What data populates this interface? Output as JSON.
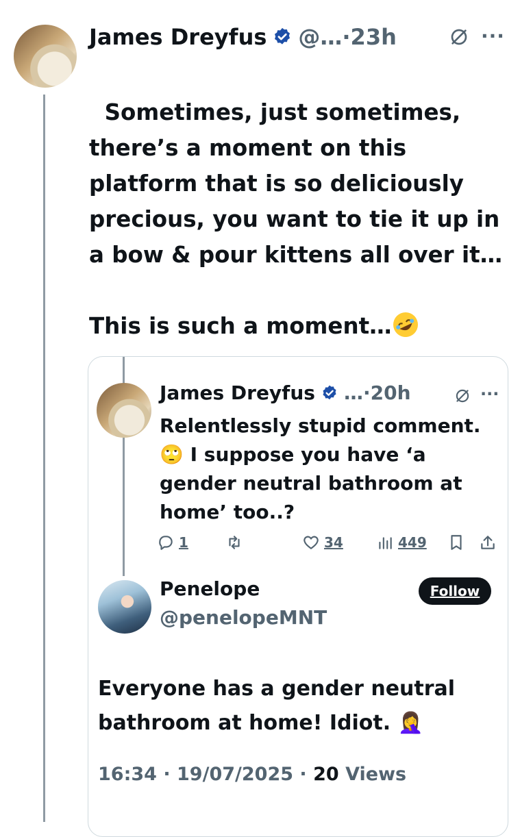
{
  "tweet": {
    "author_name": "James Dreyfus",
    "handle_truncated": "@…",
    "separator": "·",
    "time": "23h",
    "text_main": "Sometimes, just sometimes, there’s a moment on this platform that is so deliciously precious, you want to tie it up in a bow & pour kittens all over it…",
    "text_second": "This is such a moment…",
    "emoji": "rolling-on-floor-laughing",
    "verified": true
  },
  "quoted": {
    "author_name": "James Dreyfus",
    "handle_truncated": "…",
    "separator": "·",
    "time": "20h",
    "text": "Relentlessly stupid comment. 🙄 I suppose you have ‘a gender neutral bathroom at home’ too..?",
    "actions": {
      "reply_count": "1",
      "repost_count": "",
      "like_count": "34",
      "views_count": "449"
    },
    "reply": {
      "author_name": "Penelope",
      "handle": "@penelopeMNT",
      "follow_label": "Follow",
      "text": "Everyone has a gender neutral bathroom at home! Idiot. 🤦‍♀️",
      "time": "16:34",
      "date": "19/07/2025",
      "views_count": "20",
      "views_label": "Views"
    }
  },
  "colors": {
    "text": "#0f1419",
    "muted": "#536471",
    "verified": "#1d4fa8",
    "border": "#cfd9de"
  }
}
